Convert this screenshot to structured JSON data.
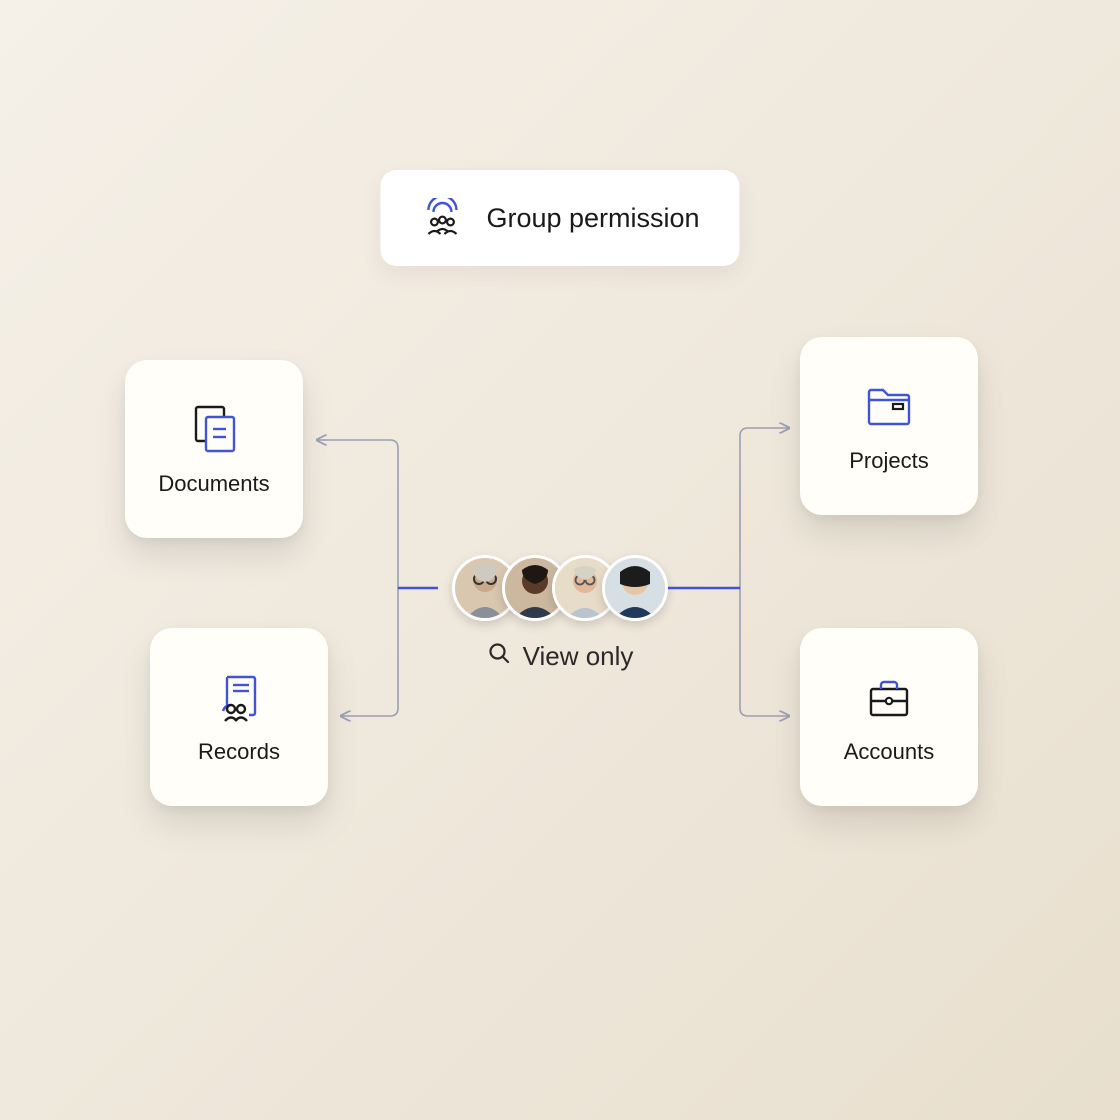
{
  "header": {
    "label": "Group permission"
  },
  "center": {
    "permission_label": "View only",
    "avatar_count": 4
  },
  "nodes": {
    "documents": {
      "label": "Documents"
    },
    "records": {
      "label": "Records"
    },
    "projects": {
      "label": "Projects"
    },
    "accounts": {
      "label": "Accounts"
    }
  },
  "colors": {
    "accent": "#4154d6",
    "ink": "#1a1a1a",
    "connector": "#9aa0b4"
  }
}
